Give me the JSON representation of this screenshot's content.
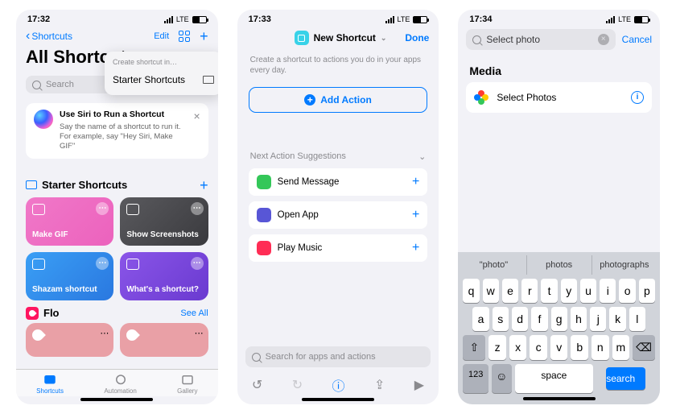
{
  "phone1": {
    "time": "17:32",
    "net": "LTE",
    "back": "Shortcuts",
    "edit": "Edit",
    "title": "All Shortcuts",
    "popover": {
      "header": "Create shortcut in…",
      "item": "Starter Shortcuts"
    },
    "search_ph": "Search",
    "siri": {
      "title": "Use Siri to Run a Shortcut",
      "body": "Say the name of a shortcut to run it. For example, say \"Hey Siri, Make GIF\""
    },
    "starter_title": "Starter Shortcuts",
    "cards": [
      "Make GIF",
      "Show Screenshots",
      "Shazam shortcut",
      "What's a shortcut?"
    ],
    "flo": "Flo",
    "seeall": "See All",
    "tabs": [
      "Shortcuts",
      "Automation",
      "Gallery"
    ]
  },
  "phone2": {
    "time": "17:33",
    "net": "LTE",
    "title": "New Shortcut",
    "done": "Done",
    "sub": "Create a shortcut to actions you do in your apps every day.",
    "addaction": "Add Action",
    "sugg_h": "Next Action Suggestions",
    "suggestions": [
      "Send Message",
      "Open App",
      "Play Music"
    ],
    "bottom_search": "Search for apps and actions"
  },
  "phone3": {
    "time": "17:34",
    "net": "LTE",
    "search_value": "Select photo",
    "cancel": "Cancel",
    "media_h": "Media",
    "action": "Select Photos",
    "predictions": [
      "\"photo\"",
      "photos",
      "photographs"
    ],
    "rows": [
      [
        "q",
        "w",
        "e",
        "r",
        "t",
        "y",
        "u",
        "i",
        "o",
        "p"
      ],
      [
        "a",
        "s",
        "d",
        "f",
        "g",
        "h",
        "j",
        "k",
        "l"
      ],
      [
        "⇧",
        "z",
        "x",
        "c",
        "v",
        "b",
        "n",
        "m",
        "⌫"
      ]
    ],
    "space": "space",
    "search": "search",
    "numkey": "123"
  }
}
